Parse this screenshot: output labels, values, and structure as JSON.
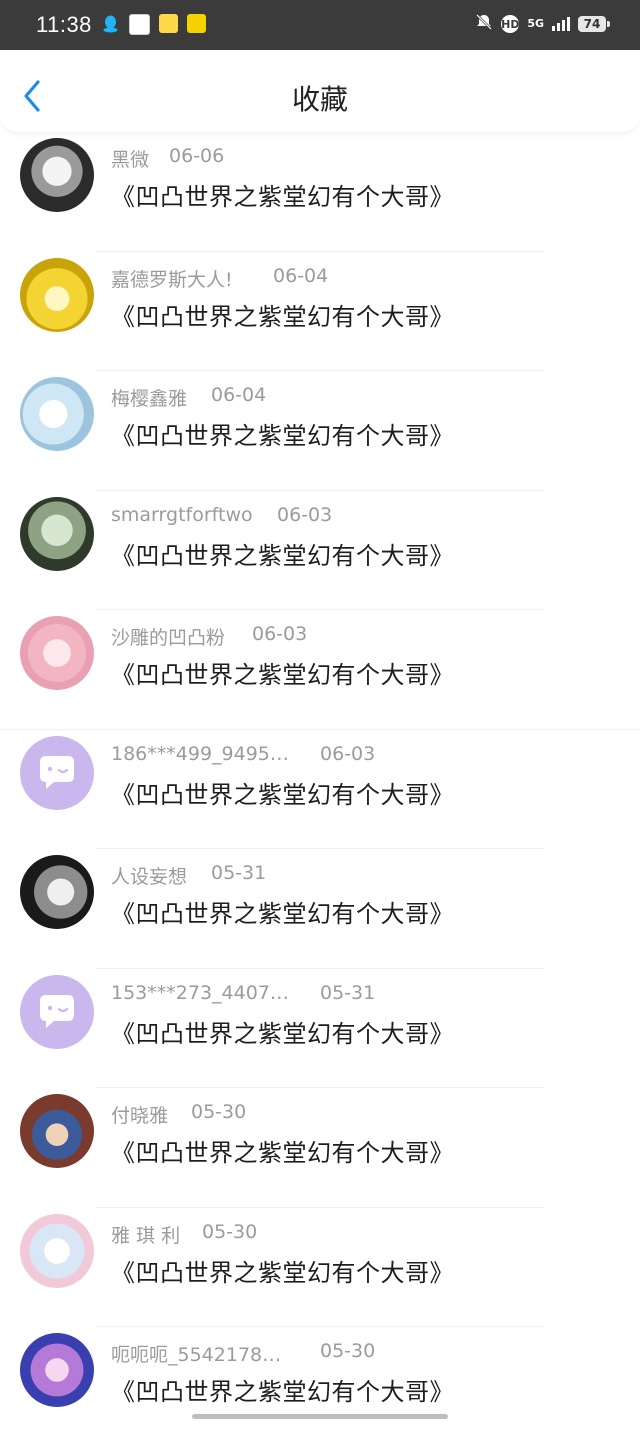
{
  "status_bar": {
    "time": "11:38",
    "hd": "HD",
    "network": "5G",
    "battery": "74"
  },
  "header": {
    "title": "收藏"
  },
  "items": [
    {
      "user": "黑微",
      "date": "06-06",
      "title": "《凹凸世界之紫堂幻有个大哥》"
    },
    {
      "user": "嘉德罗斯大人!",
      "date": "06-04",
      "title": "《凹凸世界之紫堂幻有个大哥》"
    },
    {
      "user": "梅樱鑫雅",
      "date": "06-04",
      "title": "《凹凸世界之紫堂幻有个大哥》"
    },
    {
      "user": "smarrgtforftwo",
      "date": "06-03",
      "title": "《凹凸世界之紫堂幻有个大哥》"
    },
    {
      "user": "沙雕的凹凸粉",
      "date": "06-03",
      "title": "《凹凸世界之紫堂幻有个大哥》"
    },
    {
      "user": "186***499_9495…",
      "date": "06-03",
      "title": "《凹凸世界之紫堂幻有个大哥》"
    },
    {
      "user": "人设妄想",
      "date": "05-31",
      "title": "《凹凸世界之紫堂幻有个大哥》"
    },
    {
      "user": "153***273_4407…",
      "date": "05-31",
      "title": "《凹凸世界之紫堂幻有个大哥》"
    },
    {
      "user": "付晓雅",
      "date": "05-30",
      "title": "《凹凸世界之紫堂幻有个大哥》"
    },
    {
      "user": "雅 琪 利",
      "date": "05-30",
      "title": "《凹凸世界之紫堂幻有个大哥》"
    },
    {
      "user": "呃呃呃_5542178…",
      "date": "05-30",
      "title": "《凹凸世界之紫堂幻有个大哥》"
    }
  ],
  "colors": {
    "accent": "#1a8cf0",
    "default_avatar": "#c9b7ee"
  }
}
